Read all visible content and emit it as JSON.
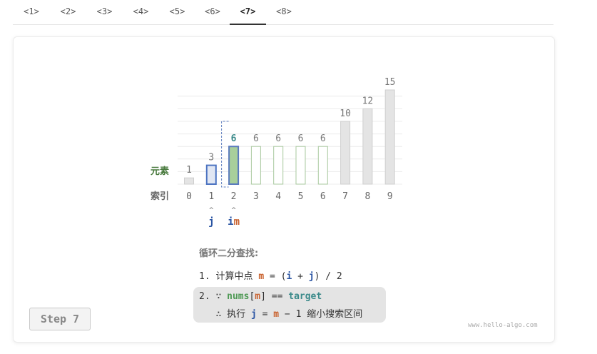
{
  "tabs": [
    {
      "label": "<1>"
    },
    {
      "label": "<2>"
    },
    {
      "label": "<3>"
    },
    {
      "label": "<4>"
    },
    {
      "label": "<5>"
    },
    {
      "label": "<6>"
    },
    {
      "label": "<7>",
      "active": true
    },
    {
      "label": "<8>"
    }
  ],
  "diagram": {
    "element_label": "元素",
    "index_label": "索引",
    "values": [
      1,
      3,
      6,
      6,
      6,
      6,
      6,
      10,
      12,
      15
    ],
    "indices": [
      0,
      1,
      2,
      3,
      4,
      5,
      6,
      7,
      8,
      9
    ],
    "pointer_j": {
      "index": 1,
      "label": "j"
    },
    "pointer_im": {
      "index": 2,
      "label_i": "i",
      "label_m": "m"
    },
    "target_index": 2,
    "colors": {
      "element_label": "#4a7b3f",
      "gray_bar_fill": "#e4e4e4",
      "gray_bar_stroke": "#cfcfcf",
      "green_bar_fill": "#ffffff",
      "green_bar_stroke": "#a9c99f",
      "target_fill": "#a8cf9b",
      "target_stroke": "#5b7bbd",
      "j_fill": "#e1e7f3",
      "j_stroke": "#4d74c1",
      "target_value": "#3b8a8a",
      "pointer_blue": "#2a54a3",
      "pointer_orange": "#c9622f"
    }
  },
  "explanation": {
    "title": "循环二分查找:",
    "line1": {
      "prefix": "1. 计算中点 ",
      "m": "m",
      "eq": " = (",
      "i": "i",
      "plus": " + ",
      "j": "j",
      "suffix": ") / 2"
    },
    "line2": {
      "prefix": "2. ∵ ",
      "nums": "nums",
      "bracket_open": "[",
      "m": "m",
      "bracket_close": "] == ",
      "target": "target"
    },
    "line3": {
      "prefix": "   ∴ 执行 ",
      "j": "j",
      "eq": " = ",
      "m": "m",
      "suffix": " − 1 缩小搜索区间"
    }
  },
  "step_button": "Step 7",
  "watermark": "www.hello-algo.com"
}
